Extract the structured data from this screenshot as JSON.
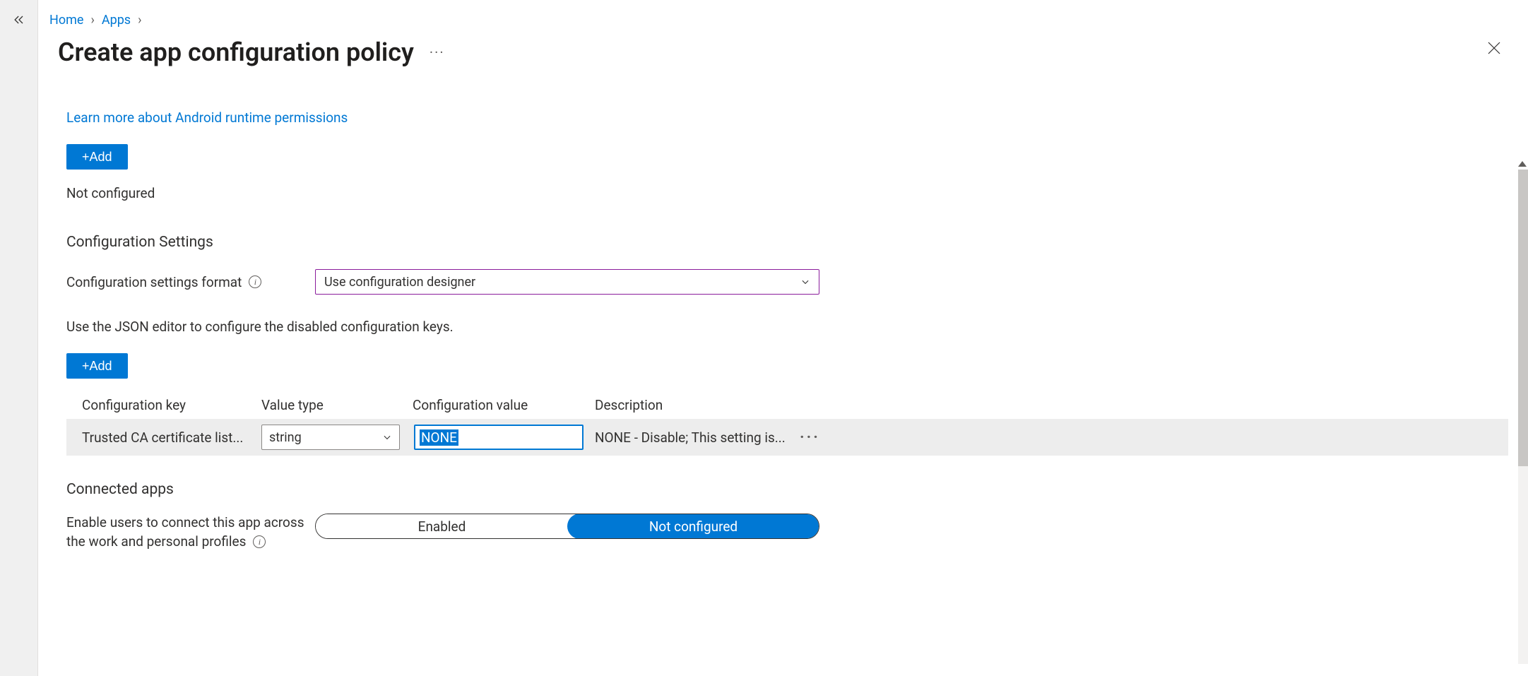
{
  "breadcrumb": {
    "home": "Home",
    "apps": "Apps"
  },
  "header": {
    "title": "Create app configuration policy"
  },
  "links": {
    "learn_more": "Learn more about Android runtime permissions"
  },
  "buttons": {
    "add": "+Add"
  },
  "status": {
    "not_configured": "Not configured"
  },
  "sections": {
    "config_settings": "Configuration Settings",
    "connected_apps": "Connected apps"
  },
  "fields": {
    "format_label": "Configuration settings format",
    "format_value": "Use configuration designer",
    "json_helper": "Use the JSON editor to configure the disabled configuration keys."
  },
  "table": {
    "headers": {
      "key": "Configuration key",
      "type": "Value type",
      "value": "Configuration value",
      "desc": "Description"
    },
    "rows": [
      {
        "key": "Trusted CA certificate list...",
        "type": "string",
        "value": "NONE",
        "desc": "NONE - Disable; This setting is..."
      }
    ]
  },
  "connected": {
    "label": "Enable users to connect this app across",
    "label2": "the work and personal profiles",
    "enabled": "Enabled",
    "not_configured": "Not configured"
  }
}
